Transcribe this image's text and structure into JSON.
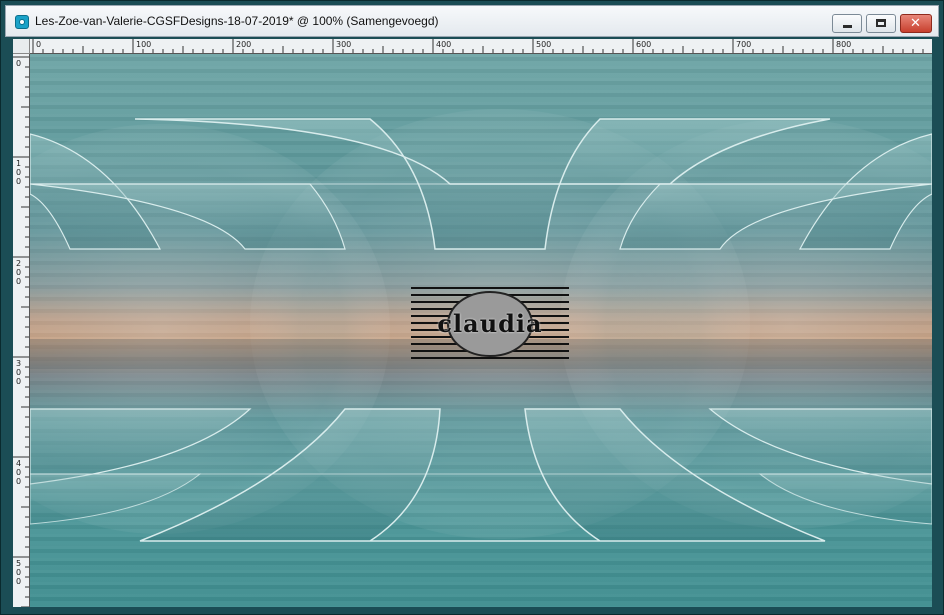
{
  "window": {
    "title": "Les-Zoe-van-Valerie-CGSFDesigns-18-07-2019* @ 100% (Samengevoegd)",
    "icon": "paintshop-icon",
    "controls": {
      "minimize_icon": "minimize-icon",
      "maximize_icon": "maximize-icon",
      "close_icon": "close-icon"
    }
  },
  "ruler": {
    "top_labels": [
      "0",
      "100",
      "200",
      "300",
      "400",
      "500",
      "600",
      "700",
      "800"
    ],
    "left_labels": [
      "0",
      "100",
      "200",
      "300",
      "400",
      "500"
    ]
  },
  "canvas": {
    "watermark_text": "claudia",
    "colors": {
      "sky_top": "#6ea5a6",
      "sunset": "#d29a74",
      "sea_bottom": "#3f8e90",
      "frame": "#1b4d55"
    }
  }
}
